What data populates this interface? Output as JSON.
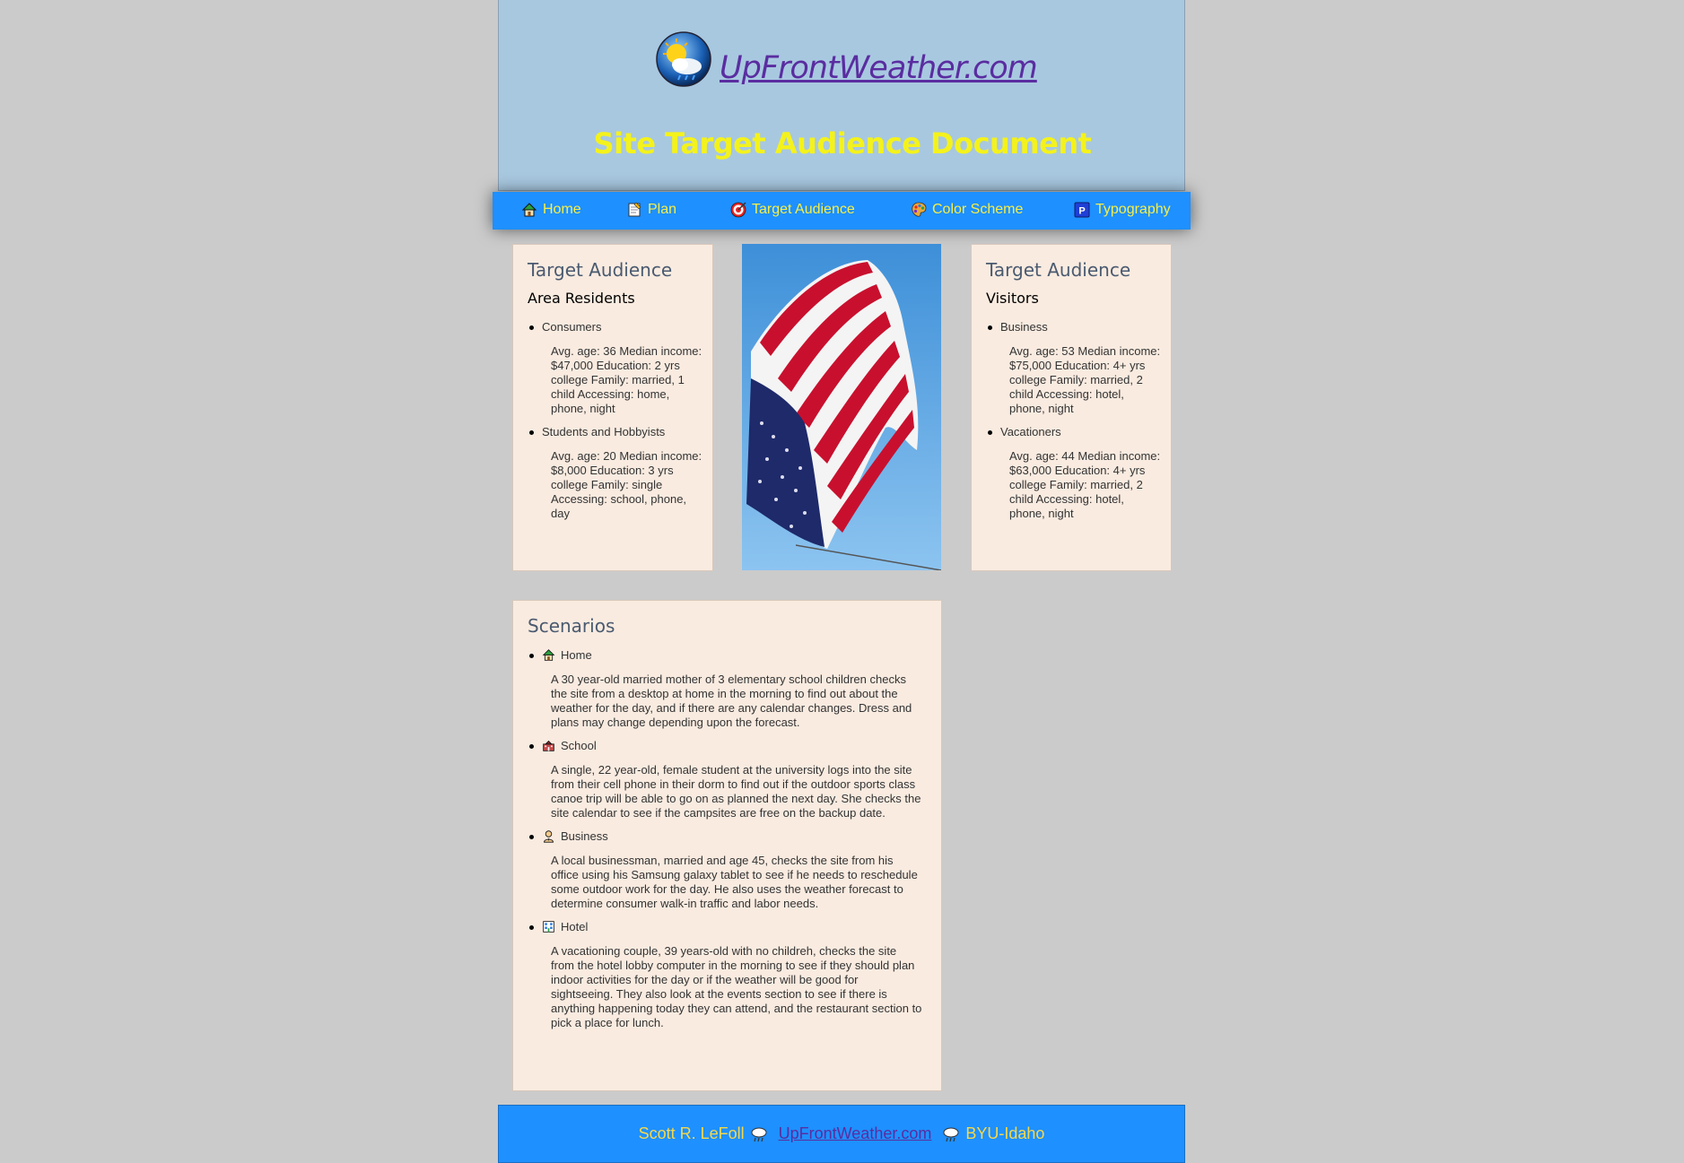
{
  "header": {
    "site_name": "UpFrontWeather.com",
    "title": "Site Target Audience Document",
    "logo_icon": "sun-cloud-logo-icon"
  },
  "nav": {
    "items": [
      {
        "label": "Home",
        "icon": "house-icon"
      },
      {
        "label": "Plan",
        "icon": "memo-icon"
      },
      {
        "label": "Target Audience",
        "icon": "target-icon"
      },
      {
        "label": "Color Scheme",
        "icon": "palette-icon"
      },
      {
        "label": "Typography",
        "icon": "p-square-icon"
      }
    ]
  },
  "residents": {
    "heading": "Target Audience",
    "subheading": "Area Residents",
    "groups": [
      {
        "label": "Consumers",
        "details": "Avg. age: 36 Median income: $47,000 Education: 2 yrs college Family: married, 1 child Accessing: home, phone, night"
      },
      {
        "label": "Students and Hobbyists",
        "details": "Avg. age: 20 Median income: $8,000 Education: 3 yrs college Family: single Accessing: school, phone, day"
      }
    ]
  },
  "visitors": {
    "heading": "Target Audience",
    "subheading": "Visitors",
    "groups": [
      {
        "label": "Business",
        "details": "Avg. age: 53 Median income: $75,000 Education: 4+ yrs college Family: married, 2 child Accessing: hotel, phone, night"
      },
      {
        "label": "Vacationers",
        "details": "Avg. age: 44 Median income: $63,000 Education: 4+ yrs college Family: married, 2 child Accessing: hotel, phone, night"
      }
    ]
  },
  "scenarios": {
    "heading": "Scenarios",
    "items": [
      {
        "label": "Home",
        "icon": "house-icon",
        "text": "A 30 year-old married mother of 3 elementary school children checks the site from a desktop at home in the morning to find out about the weather for the day, and if there are any calendar changes. Dress and plans may change depending upon the forecast."
      },
      {
        "label": "School",
        "icon": "school-icon",
        "text": "A single, 22 year-old, female student at the university logs into the site from their cell phone in their dorm to find out if the outdoor sports class canoe trip will be able to go on as planned the next day. She checks the site calendar to see if the campsites are free on the backup date."
      },
      {
        "label": "Business",
        "icon": "businessman-icon",
        "text": "A local businessman, married and age 45, checks the site from his office using his Samsung galaxy tablet to see if he needs to reschedule some outdoor work for the day. He also uses the weather forecast to determine consumer walk-in traffic and labor needs."
      },
      {
        "label": "Hotel",
        "icon": "hotel-icon",
        "text": "A vacationing couple, 39 years-old with no childreh, checks the site from the hotel lobby computer in the morning to see if they should plan indoor activities for the day or if the weather will be good for sightseeing. They also look at the events section to see if there is anything happening today they can attend, and the restaurant section to pick a place for lunch."
      }
    ]
  },
  "footer": {
    "author": "Scott R. LeFoll",
    "link": "UpFrontWeather.com",
    "school": "BYU-Idaho",
    "icon": "cloud-rain-icon"
  },
  "colors": {
    "background": "#cbcbcb",
    "header_bg": "#a8c8e0",
    "nav_bg": "#1e90ff",
    "nav_text": "#f6ee48",
    "title_yellow": "#f4f21c",
    "card_bg": "#f9ebe0"
  }
}
